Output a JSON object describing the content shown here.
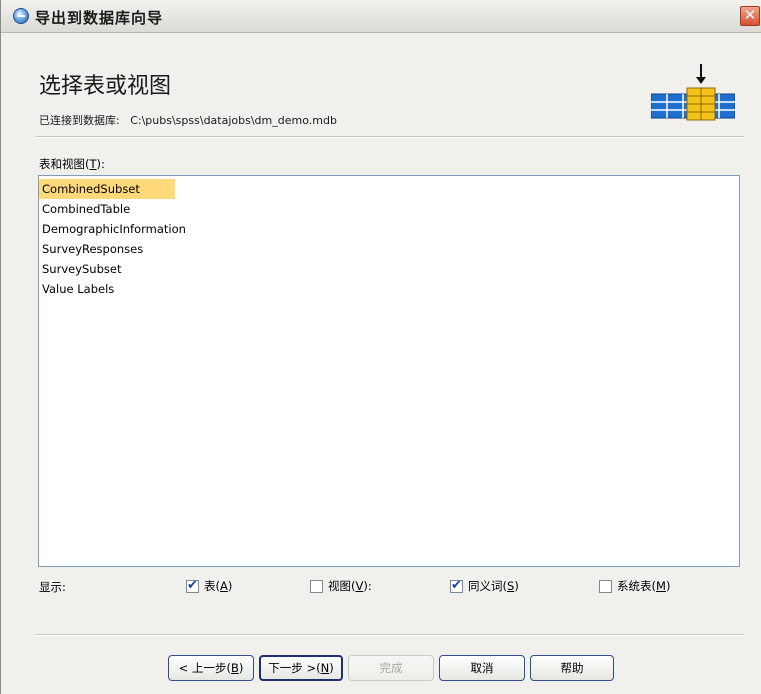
{
  "window": {
    "title": "导出到数据库向导",
    "close_glyph": "✕"
  },
  "header": {
    "heading": "选择表或视图",
    "connection_label": "已连接到数据库:",
    "connection_path": "C:\\pubs\\spss\\datajobs\\dm_demo.mdb"
  },
  "tables": {
    "label": "表和视图",
    "label_key": "T",
    "label_suffix": "):",
    "items": [
      {
        "label": "CombinedSubset",
        "selected": true
      },
      {
        "label": "CombinedTable",
        "selected": false
      },
      {
        "label": "DemographicInformation",
        "selected": false
      },
      {
        "label": "SurveyResponses",
        "selected": false
      },
      {
        "label": "SurveySubset",
        "selected": false
      },
      {
        "label": "Value Labels",
        "selected": false
      }
    ]
  },
  "show": {
    "label": "显示:",
    "options": [
      {
        "label": "表",
        "key": "A",
        "suffix": ")",
        "checked": true
      },
      {
        "label": "视图",
        "key": "V",
        "suffix": "):",
        "checked": false
      },
      {
        "label": "同义词",
        "key": "S",
        "suffix": ")",
        "checked": true
      },
      {
        "label": "系统表",
        "key": "M",
        "suffix": ")",
        "checked": false
      }
    ]
  },
  "buttons": {
    "back": {
      "label": "< 上一步(",
      "key": "B",
      "suffix": ")"
    },
    "next": {
      "label": "下一步 >(",
      "key": "N",
      "suffix": ")"
    },
    "finish": {
      "label": "完成"
    },
    "cancel": {
      "label": "取消"
    },
    "help": {
      "label": "帮助"
    }
  },
  "colors": {
    "accent_selected": "#ffd97a",
    "close_button": "#d8502f",
    "db_icon_blue": "#1e6fd0",
    "db_icon_gold": "#f4c21a"
  }
}
